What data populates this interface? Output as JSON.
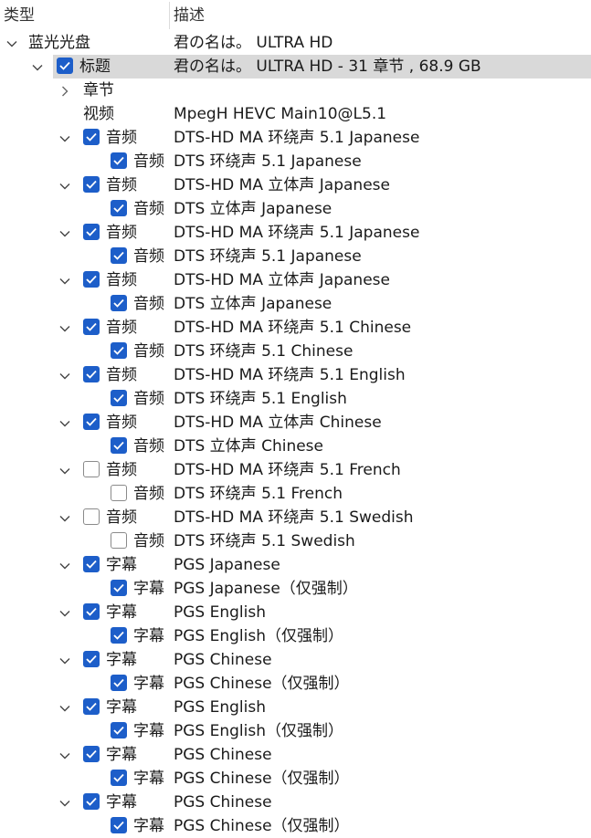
{
  "header": {
    "type_label": "类型",
    "desc_label": "描述"
  },
  "colors": {
    "checkbox_checked": "#1d5ec9",
    "selection": "#d9d9d9"
  },
  "rows": [
    {
      "level": 0,
      "expander": "expanded",
      "checkbox": null,
      "type": "蓝光光盘",
      "desc": "君の名は。  ULTRA HD"
    },
    {
      "level": 1,
      "expander": "expanded",
      "checkbox": true,
      "selected": true,
      "type": "标题",
      "desc": "君の名は。  ULTRA HD - 31 章节 , 68.9 GB"
    },
    {
      "level": 2,
      "expander": "collapsed",
      "checkbox": null,
      "type": "章节",
      "desc": ""
    },
    {
      "level": 2,
      "expander": null,
      "checkbox": null,
      "type": "视频",
      "desc": "MpegH HEVC Main10@L5.1"
    },
    {
      "level": 2,
      "expander": "expanded",
      "checkbox": true,
      "type": "音频",
      "desc": "DTS-HD MA 环绕声 5.1 Japanese"
    },
    {
      "level": 3,
      "expander": null,
      "checkbox": true,
      "type": "音频",
      "desc": "DTS 环绕声 5.1 Japanese"
    },
    {
      "level": 2,
      "expander": "expanded",
      "checkbox": true,
      "type": "音频",
      "desc": "DTS-HD MA 立体声 Japanese"
    },
    {
      "level": 3,
      "expander": null,
      "checkbox": true,
      "type": "音频",
      "desc": "DTS 立体声 Japanese"
    },
    {
      "level": 2,
      "expander": "expanded",
      "checkbox": true,
      "type": "音频",
      "desc": "DTS-HD MA 环绕声 5.1 Japanese"
    },
    {
      "level": 3,
      "expander": null,
      "checkbox": true,
      "type": "音频",
      "desc": "DTS 环绕声 5.1 Japanese"
    },
    {
      "level": 2,
      "expander": "expanded",
      "checkbox": true,
      "type": "音频",
      "desc": "DTS-HD MA 立体声 Japanese"
    },
    {
      "level": 3,
      "expander": null,
      "checkbox": true,
      "type": "音频",
      "desc": "DTS 立体声 Japanese"
    },
    {
      "level": 2,
      "expander": "expanded",
      "checkbox": true,
      "type": "音频",
      "desc": "DTS-HD MA 环绕声 5.1 Chinese"
    },
    {
      "level": 3,
      "expander": null,
      "checkbox": true,
      "type": "音频",
      "desc": "DTS 环绕声 5.1 Chinese"
    },
    {
      "level": 2,
      "expander": "expanded",
      "checkbox": true,
      "type": "音频",
      "desc": "DTS-HD MA 环绕声 5.1 English"
    },
    {
      "level": 3,
      "expander": null,
      "checkbox": true,
      "type": "音频",
      "desc": "DTS 环绕声 5.1 English"
    },
    {
      "level": 2,
      "expander": "expanded",
      "checkbox": true,
      "type": "音频",
      "desc": "DTS-HD MA 立体声 Chinese"
    },
    {
      "level": 3,
      "expander": null,
      "checkbox": true,
      "type": "音频",
      "desc": "DTS 立体声 Chinese"
    },
    {
      "level": 2,
      "expander": "expanded",
      "checkbox": false,
      "type": "音频",
      "desc": "DTS-HD MA 环绕声 5.1 French"
    },
    {
      "level": 3,
      "expander": null,
      "checkbox": false,
      "type": "音频",
      "desc": "DTS 环绕声 5.1 French"
    },
    {
      "level": 2,
      "expander": "expanded",
      "checkbox": false,
      "type": "音频",
      "desc": "DTS-HD MA 环绕声 5.1 Swedish"
    },
    {
      "level": 3,
      "expander": null,
      "checkbox": false,
      "type": "音频",
      "desc": "DTS 环绕声 5.1 Swedish"
    },
    {
      "level": 2,
      "expander": "expanded",
      "checkbox": true,
      "type": "字幕",
      "desc": "PGS Japanese"
    },
    {
      "level": 3,
      "expander": null,
      "checkbox": true,
      "type": "字幕",
      "desc": "PGS Japanese（仅强制）"
    },
    {
      "level": 2,
      "expander": "expanded",
      "checkbox": true,
      "type": "字幕",
      "desc": "PGS English"
    },
    {
      "level": 3,
      "expander": null,
      "checkbox": true,
      "type": "字幕",
      "desc": "PGS English（仅强制）"
    },
    {
      "level": 2,
      "expander": "expanded",
      "checkbox": true,
      "type": "字幕",
      "desc": "PGS Chinese"
    },
    {
      "level": 3,
      "expander": null,
      "checkbox": true,
      "type": "字幕",
      "desc": "PGS Chinese（仅强制）"
    },
    {
      "level": 2,
      "expander": "expanded",
      "checkbox": true,
      "type": "字幕",
      "desc": "PGS English"
    },
    {
      "level": 3,
      "expander": null,
      "checkbox": true,
      "type": "字幕",
      "desc": "PGS English（仅强制）"
    },
    {
      "level": 2,
      "expander": "expanded",
      "checkbox": true,
      "type": "字幕",
      "desc": "PGS Chinese"
    },
    {
      "level": 3,
      "expander": null,
      "checkbox": true,
      "type": "字幕",
      "desc": "PGS Chinese（仅强制）"
    },
    {
      "level": 2,
      "expander": "expanded",
      "checkbox": true,
      "type": "字幕",
      "desc": "PGS Chinese"
    },
    {
      "level": 3,
      "expander": null,
      "checkbox": true,
      "type": "字幕",
      "desc": "PGS Chinese（仅强制）"
    }
  ]
}
